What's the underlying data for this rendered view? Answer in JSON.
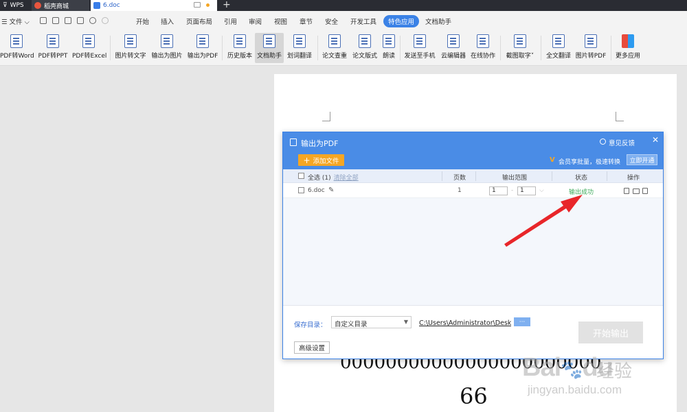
{
  "tabs": {
    "wps": "WPS",
    "store": "稻壳商城",
    "doc": "6.doc",
    "new_tab": "+"
  },
  "menu": {
    "file": "文件",
    "items": [
      "开始",
      "插入",
      "页面布局",
      "引用",
      "审阅",
      "视图",
      "章节",
      "安全",
      "开发工具",
      "特色应用",
      "文档助手"
    ],
    "active": "特色应用"
  },
  "toolbar": {
    "buttons": [
      "PDF转Word",
      "PDF转PPT",
      "PDF转Excel",
      "图片转文字",
      "输出为图片",
      "输出为PDF",
      "历史版本",
      "文档助手",
      "划词翻译",
      "论文查重",
      "论文版式",
      "朗读",
      "发送至手机",
      "云编辑器",
      "在线协作",
      "截图取字",
      "全文翻译",
      "图片转PDF",
      "更多应用"
    ]
  },
  "document": {
    "zeros": "00000000000000000000000",
    "number": "66"
  },
  "dialog": {
    "title": "输出为PDF",
    "feedback": "意见反馈",
    "close": "✕",
    "add_file": "添加文件",
    "vip_mark": "V",
    "vip_text": "会员享批量，极速转换",
    "open_vip": "立即开通",
    "table": {
      "select_all": "全选 (1)",
      "clear_all": "清除全部",
      "headers": [
        "页数",
        "输出范围",
        "状态",
        "操作"
      ],
      "rows": [
        {
          "name": "6.doc",
          "pages": "1",
          "range_from": "1",
          "range_sep": "-",
          "range_to": "1",
          "status": "输出成功"
        }
      ]
    },
    "save_label": "保存目录：",
    "save_option": "自定义目录",
    "save_path": "C:\\Users\\Administrator\\Desktop",
    "browse": "···",
    "start": "开始输出",
    "advanced": "高级设置"
  },
  "watermark": {
    "logo": "Bai",
    "logo_suffix": "du",
    "cn": "经验",
    "url": "jingyan.baidu.com"
  },
  "colors": {
    "accent": "#3b82e6",
    "dialog_header": "#4a8ce6",
    "add_button": "#f5a623",
    "success": "#3caa5a",
    "arrow": "#e8262a"
  }
}
